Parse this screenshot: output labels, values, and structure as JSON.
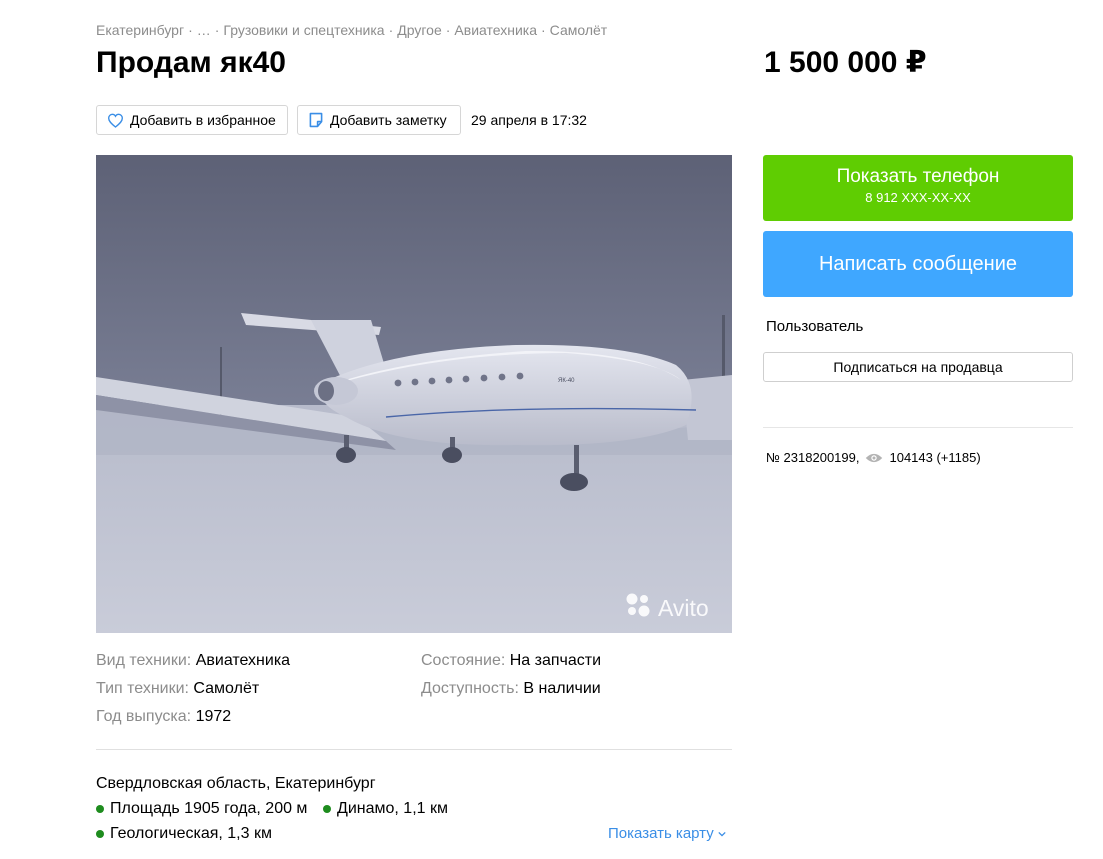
{
  "breadcrumbs": [
    {
      "label": "Екатеринбург"
    },
    {
      "label": "…"
    },
    {
      "label": "Грузовики и спецтехника"
    },
    {
      "label": "Другое"
    },
    {
      "label": "Авиатехника"
    },
    {
      "label": "Самолёт"
    }
  ],
  "breadcrumb_separator": "·",
  "listing": {
    "title": "Продам як40",
    "price": "1 500 000 ₽",
    "date": "29 апреля в 17:32"
  },
  "actions": {
    "favorite_label": "Добавить в избранное",
    "note_label": "Добавить заметку"
  },
  "photo": {
    "watermark": "Avito",
    "aircraft_text": "ЯК-40"
  },
  "contact": {
    "phone_button_label": "Показать телефон",
    "phone_masked": "8 912 XXX-XX-XX",
    "message_button_label": "Написать сообщение",
    "seller_name": "Пользователь",
    "subscribe_label": "Подписаться на продавца"
  },
  "stats": {
    "ad_number": "№ 2318200199,",
    "views": "104143 (+1185)"
  },
  "params": [
    {
      "key": "Вид техники:",
      "value": "Авиатехника"
    },
    {
      "key": "Состояние:",
      "value": "На запчасти"
    },
    {
      "key": "Тип техники:",
      "value": "Самолёт"
    },
    {
      "key": "Доступность:",
      "value": "В наличии"
    },
    {
      "key": "Год выпуска:",
      "value": "1972"
    }
  ],
  "location": {
    "address": "Свердловская область, Екатеринбург",
    "metro": [
      {
        "name": "Площадь 1905 года, 200 м"
      },
      {
        "name": "Динамо, 1,1 км"
      },
      {
        "name": "Геологическая, 1,3 км"
      }
    ],
    "map_link_label": "Показать карту",
    "metro_color": "#1e8c1e"
  },
  "colors": {
    "phone_button": "#5fcd02",
    "message_button": "#3fa7ff",
    "link": "#3a8ee6"
  }
}
